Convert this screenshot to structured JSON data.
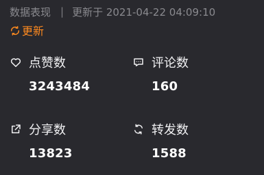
{
  "header": {
    "section_title": "数据表现",
    "separator": "|",
    "updated_text": "更新于 2021-04-22 04:09:10",
    "update_button_label": "更新"
  },
  "metrics": [
    {
      "icon": "heart-icon",
      "label": "点赞数",
      "value": "3243484"
    },
    {
      "icon": "comment-icon",
      "label": "评论数",
      "value": "160"
    },
    {
      "icon": "share-icon",
      "label": "分享数",
      "value": "13823"
    },
    {
      "icon": "repost-icon",
      "label": "转发数",
      "value": "1588"
    }
  ],
  "colors": {
    "background": "#29292e",
    "accent": "#ff8a1f",
    "muted_text": "#8a8a8f",
    "text": "#f0f0f2"
  }
}
